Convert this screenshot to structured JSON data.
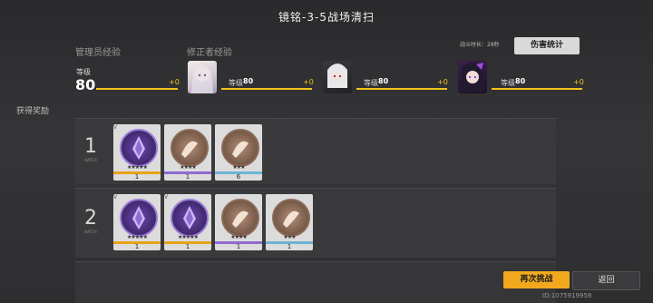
{
  "title": "镜铭-3-5战场清扫",
  "admin": {
    "label": "管理员经验",
    "level_label": "等级",
    "level": "80",
    "gain": "+0",
    "progress": 1.0
  },
  "fixer": {
    "label": "修正者经验",
    "members": [
      {
        "level_label": "等级",
        "level": "80",
        "gain": "+0",
        "progress": 1.0,
        "portrait": "silver-haired-girl"
      },
      {
        "level_label": "等级",
        "level": "80",
        "gain": "+0",
        "progress": 1.0,
        "portrait": "white-haired-girl"
      },
      {
        "level_label": "等级",
        "level": "80",
        "gain": "+0",
        "progress": 1.0,
        "portrait": "dark-haired-girl"
      }
    ]
  },
  "battle_time": "战斗时长：28秒",
  "damage_button": "伤害统计",
  "rewards_label": "获得奖励",
  "batch_label": "BATCH",
  "batches": [
    {
      "num": "1",
      "items": [
        {
          "qty": "1",
          "stars": "★★★★★",
          "type": "purple",
          "rank": "V"
        },
        {
          "qty": "1",
          "stars": "★★★★",
          "type": "brown",
          "rank": ""
        },
        {
          "qty": "6",
          "stars": "★★★",
          "type": "brown",
          "rank": ""
        }
      ]
    },
    {
      "num": "2",
      "items": [
        {
          "qty": "1",
          "stars": "★★★★★",
          "type": "purple",
          "rank": "V"
        },
        {
          "qty": "1",
          "stars": "★★★★★",
          "type": "purple",
          "rank": "V"
        },
        {
          "qty": "1",
          "stars": "★★★★",
          "type": "brown",
          "rank": ""
        },
        {
          "qty": "1",
          "stars": "★★★",
          "type": "brown",
          "rank": ""
        }
      ]
    }
  ],
  "retry_button": "再次挑战",
  "back_button": "返回",
  "user_id": "ID:1075919958",
  "colors": {
    "accent": "#f2c318",
    "retry_bg": "#f3a91e",
    "purple": "#4b2a7e",
    "brown": "#7a5a48",
    "gold_stripe": "#e8a318",
    "purple_stripe": "#8e6bd0",
    "blue_stripe": "#6fb3d6"
  }
}
